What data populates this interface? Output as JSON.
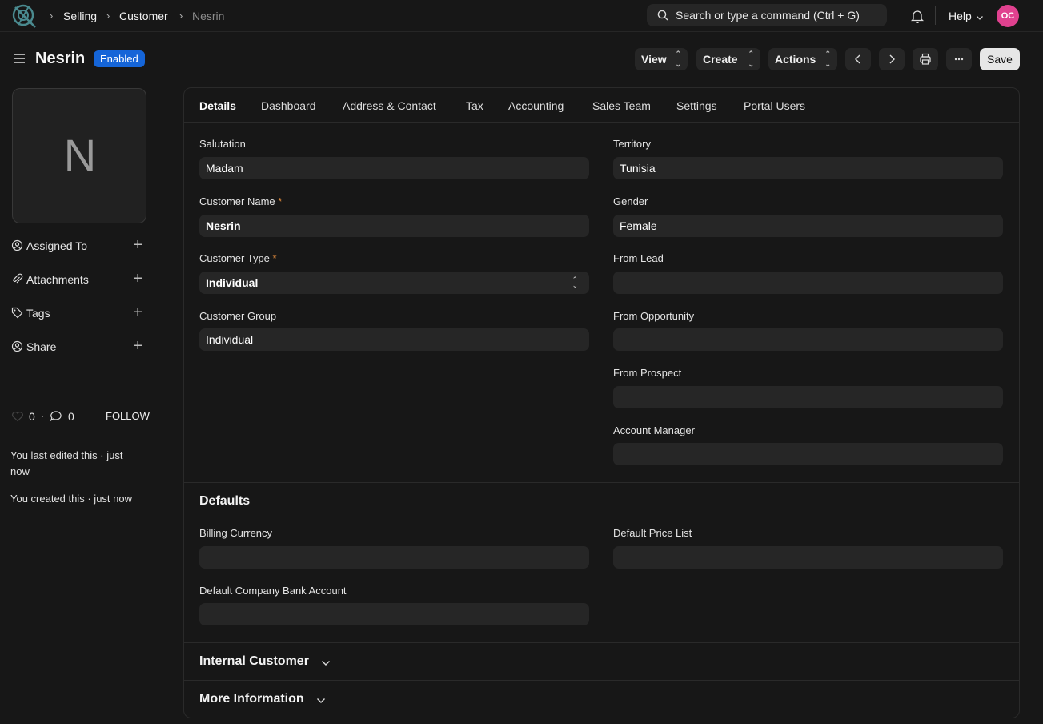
{
  "colors": {
    "accent": "#1565d8",
    "avatar_bg": "#e0418f",
    "background": "#171717",
    "field_bg": "#262626"
  },
  "nav": {
    "logo_icon": "app-logo",
    "breadcrumbs": [
      "Selling",
      "Customer",
      "Nesrin"
    ],
    "search_placeholder": "Search or type a command (Ctrl + G)",
    "help_label": "Help",
    "avatar_initials": "OC"
  },
  "header": {
    "title": "Nesrin",
    "status": "Enabled",
    "view_label": "View",
    "create_label": "Create",
    "actions_label": "Actions",
    "save_label": "Save"
  },
  "sidebar": {
    "image_initial": "N",
    "items": [
      {
        "label": "Assigned To",
        "icon": "assign-icon"
      },
      {
        "label": "Attachments",
        "icon": "paperclip-icon"
      },
      {
        "label": "Tags",
        "icon": "tag-icon"
      },
      {
        "label": "Share",
        "icon": "share-icon"
      }
    ],
    "likes": "0",
    "comments": "0",
    "follow_label": "FOLLOW",
    "last_edited": "You last edited this · just",
    "last_edited_2": "now",
    "created": "You created this · just now"
  },
  "tabs": [
    "Details",
    "Dashboard",
    "Address & Contact",
    "Tax",
    "Accounting",
    "Sales Team",
    "Settings",
    "Portal Users"
  ],
  "details": {
    "salutation": {
      "label": "Salutation",
      "value": "Madam"
    },
    "customer_name": {
      "label": "Customer Name",
      "value": "Nesrin"
    },
    "customer_type": {
      "label": "Customer Type",
      "value": "Individual"
    },
    "customer_group": {
      "label": "Customer Group",
      "value": "Individual"
    },
    "territory": {
      "label": "Territory",
      "value": "Tunisia"
    },
    "gender": {
      "label": "Gender",
      "value": "Female"
    },
    "from_lead": {
      "label": "From Lead",
      "value": ""
    },
    "from_opportunity": {
      "label": "From Opportunity",
      "value": ""
    },
    "from_prospect": {
      "label": "From Prospect",
      "value": ""
    },
    "account_manager": {
      "label": "Account Manager",
      "value": ""
    }
  },
  "defaults": {
    "title": "Defaults",
    "billing_currency": {
      "label": "Billing Currency",
      "value": ""
    },
    "default_price_list": {
      "label": "Default Price List",
      "value": ""
    },
    "default_bank_account": {
      "label": "Default Company Bank Account",
      "value": ""
    }
  },
  "sections": {
    "internal_customer": "Internal Customer",
    "more_information": "More Information"
  }
}
